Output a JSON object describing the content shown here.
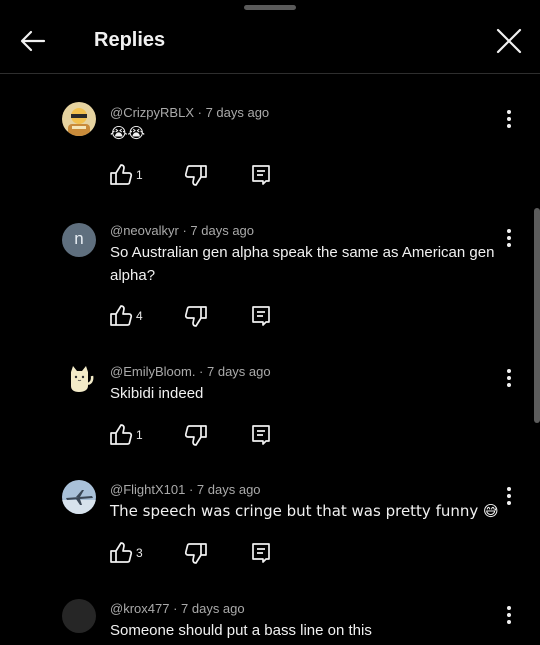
{
  "header": {
    "title": "Replies"
  },
  "replies": [
    {
      "author": "@CrizpyRBLX",
      "time": "7 days ago",
      "text": "😭😭",
      "likes": "1",
      "avatar": {
        "style": "photo",
        "letter": "",
        "color": "#e0c27a"
      }
    },
    {
      "author": "@neovalkyr",
      "time": "7 days ago",
      "text": "So Australian gen alpha speak the same as American gen alpha?",
      "likes": "4",
      "avatar": {
        "style": "letter",
        "letter": "n",
        "color": "#5f6f7e"
      }
    },
    {
      "author": "@EmilyBloom.",
      "time": "7 days ago",
      "text": "Skibidi indeed",
      "likes": "1",
      "avatar": {
        "style": "cat",
        "letter": "",
        "color": "#000000"
      }
    },
    {
      "author": "@FlightX101",
      "time": "7 days ago",
      "text": "The speech was cringe but that was pretty funny 😅",
      "likes": "3",
      "avatar": {
        "style": "plane",
        "letter": "",
        "color": "#9fb7d0"
      }
    },
    {
      "author": "@krox477",
      "time": "7 days ago",
      "text": "Someone should put a bass line on this",
      "likes": "",
      "avatar": {
        "style": "empty",
        "letter": "",
        "color": "#2a2a2a"
      }
    }
  ],
  "icons": {
    "back": "arrow-left-icon",
    "close": "close-icon",
    "more": "more-vert-icon",
    "like": "thumb-up-icon",
    "dislike": "thumb-down-icon",
    "reply": "comment-reply-icon"
  }
}
